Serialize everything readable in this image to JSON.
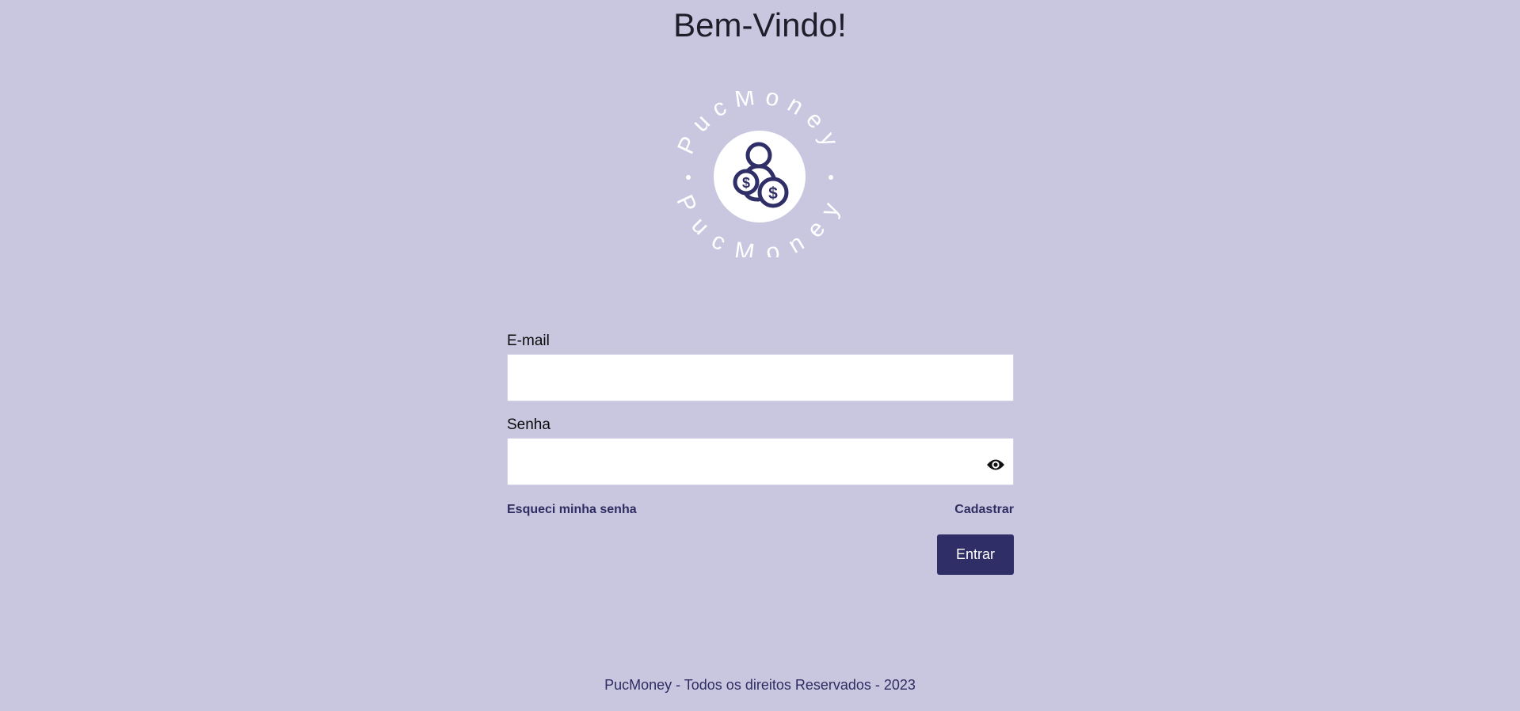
{
  "page": {
    "title": "Bem-Vindo!"
  },
  "logo": {
    "ring_text": "PucMoney",
    "icon": "person-with-coins-icon"
  },
  "form": {
    "email_label": "E-mail",
    "email_value": "",
    "password_label": "Senha",
    "password_value": "",
    "show_password_icon": "eye-icon",
    "forgot_password_link": "Esqueci minha senha",
    "register_link": "Cadastrar",
    "submit_label": "Entrar"
  },
  "footer": {
    "text": "PucMoney - Todos os direitos Reservados - 2023"
  },
  "colors": {
    "background": "#c9c7e0",
    "primary": "#302e66",
    "text": "#1e1e2a"
  }
}
